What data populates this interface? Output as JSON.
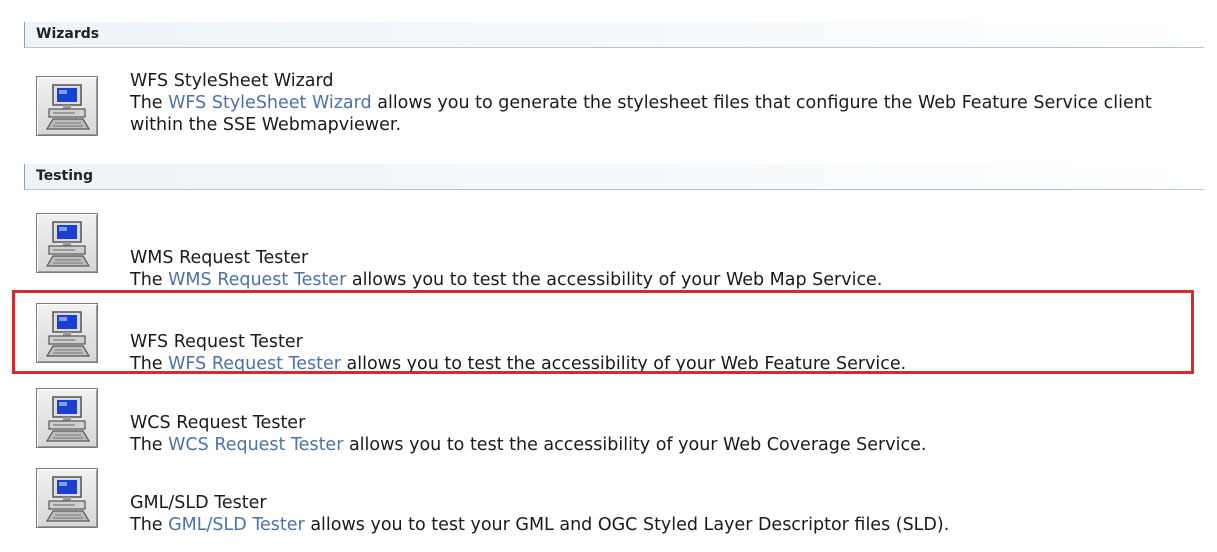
{
  "sections": {
    "wizards": {
      "label": "Wizards"
    },
    "testing": {
      "label": "Testing"
    }
  },
  "tools": {
    "wfs_stylesheet_wizard": {
      "title": "WFS StyleSheet Wizard",
      "desc_before": "The ",
      "link": "WFS StyleSheet Wizard",
      "desc_after": " allows you to generate the stylesheet files that configure the Web Feature Service client within the SSE Webmapviewer.",
      "icon": "computer-icon"
    },
    "wms_request_tester": {
      "title": "WMS Request Tester",
      "desc_before": "The ",
      "link": "WMS Request Tester",
      "desc_after": " allows you to test the accessibility of your Web Map Service.",
      "icon": "computer-icon"
    },
    "wfs_request_tester": {
      "title": "WFS Request Tester",
      "desc_before": "The ",
      "link": "WFS Request Tester",
      "desc_after": " allows you to test the accessibility of your Web Feature Service.",
      "icon": "computer-icon"
    },
    "wcs_request_tester": {
      "title": "WCS Request Tester",
      "desc_before": "The ",
      "link": "WCS Request Tester",
      "desc_after": " allows you to test the accessibility of your Web Coverage Service.",
      "icon": "computer-icon"
    },
    "gml_sld_tester": {
      "title": "GML/SLD Tester",
      "desc_before": "The ",
      "link": "GML/SLD Tester",
      "desc_after": " allows you to test your GML and OGC Styled Layer Descriptor files (SLD).",
      "icon": "computer-icon"
    }
  },
  "colors": {
    "link": "#4a73a8",
    "highlight_border": "#d42b2b",
    "header_rule": "#b7c6d3"
  }
}
